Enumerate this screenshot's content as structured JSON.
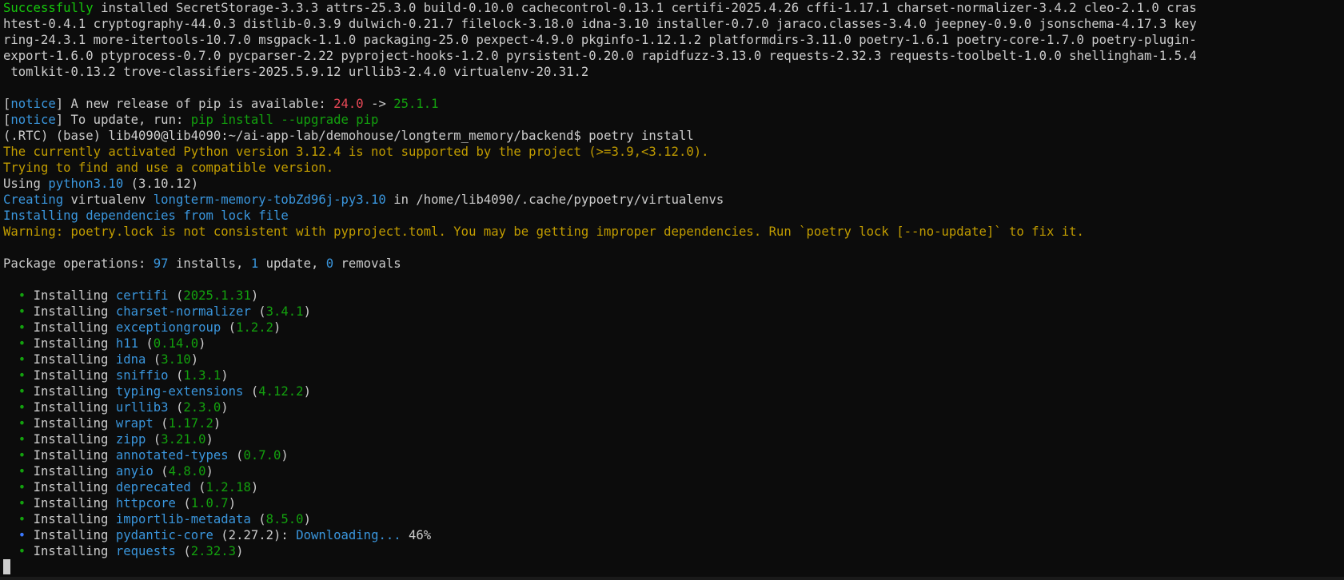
{
  "terminal": {
    "pip_success_lines": [
      "installed SecretStorage-3.3.3 attrs-25.3.0 build-0.10.0 cachecontrol-0.13.1 certifi-2025.4.26 cffi-1.17.1 charset-normalizer-3.4.2 cleo-2.1.0 cras",
      "htest-0.4.1 cryptography-44.0.3 distlib-0.3.9 dulwich-0.21.7 filelock-3.18.0 idna-3.10 installer-0.7.0 jaraco.classes-3.4.0 jeepney-0.9.0 jsonschema-4.17.3 key",
      "ring-24.3.1 more-itertools-10.7.0 msgpack-1.1.0 packaging-25.0 pexpect-4.9.0 pkginfo-1.12.1.2 platformdirs-3.11.0 poetry-1.6.1 poetry-core-1.7.0 poetry-plugin-",
      "export-1.6.0 ptyprocess-0.7.0 pycparser-2.22 pyproject-hooks-1.2.0 pyrsistent-0.20.0 rapidfuzz-3.13.0 requests-2.32.3 requests-toolbelt-1.0.0 shellingham-1.5.4",
      " tomlkit-0.13.2 trove-classifiers-2025.5.9.12 urllib3-2.4.0 virtualenv-20.31.2"
    ],
    "success_word": "Successfully",
    "notice_tag": "notice",
    "notice_release_text": "A new release of pip is available:",
    "notice_old_version": "24.0",
    "notice_arrow": "->",
    "notice_new_version": "25.1.1",
    "notice_update_text": "To update, run:",
    "notice_update_cmd": "pip install --upgrade pip",
    "prompt": "(.RTC) (base) lib4090@lib4090:~/ai-app-lab/demohouse/longterm_memory/backend$",
    "command": "poetry install",
    "python_warning": "The currently activated Python version 3.12.4 is not supported by the project (>=3.9,<3.12.0).",
    "trying_line": "Trying to find and use a compatible version.",
    "using_prefix": "Using",
    "using_python": "python3.10",
    "using_version": "(3.10.12)",
    "creating_word": "Creating",
    "creating_virtualenv": "virtualenv",
    "venv_name": "longterm-memory-tobZd96j-py3.10",
    "venv_in": "in /home/lib4090/.cache/pypoetry/virtualenvs",
    "installing_deps": "Installing dependencies from lock file",
    "lock_warning": "Warning: poetry.lock is not consistent with pyproject.toml. You may be getting improper dependencies. Run `poetry lock [--no-update]` to fix it.",
    "package_ops": {
      "prefix": "Package operations:",
      "installs_count": "97",
      "installs_label": "installs,",
      "update_count": "1",
      "update_label": "update,",
      "removals_count": "0",
      "removals_label": "removals"
    },
    "bullet": "•",
    "install_word": "Installing",
    "installs": [
      {
        "name": "certifi",
        "version": "2025.1.31"
      },
      {
        "name": "charset-normalizer",
        "version": "3.4.1"
      },
      {
        "name": "exceptiongroup",
        "version": "1.2.2"
      },
      {
        "name": "h11",
        "version": "0.14.0"
      },
      {
        "name": "idna",
        "version": "3.10"
      },
      {
        "name": "sniffio",
        "version": "1.3.1"
      },
      {
        "name": "typing-extensions",
        "version": "4.12.2"
      },
      {
        "name": "urllib3",
        "version": "2.3.0"
      },
      {
        "name": "wrapt",
        "version": "1.17.2"
      },
      {
        "name": "zipp",
        "version": "3.21.0"
      },
      {
        "name": "annotated-types",
        "version": "0.7.0"
      },
      {
        "name": "anyio",
        "version": "4.8.0"
      },
      {
        "name": "deprecated",
        "version": "1.2.18"
      },
      {
        "name": "httpcore",
        "version": "1.0.7"
      },
      {
        "name": "importlib-metadata",
        "version": "8.5.0"
      }
    ],
    "downloading": {
      "name": "pydantic-core",
      "version": "(2.27.2):",
      "status": "Downloading...",
      "percent": "46%"
    },
    "last_install": {
      "name": "requests",
      "version": "2.32.3"
    }
  }
}
